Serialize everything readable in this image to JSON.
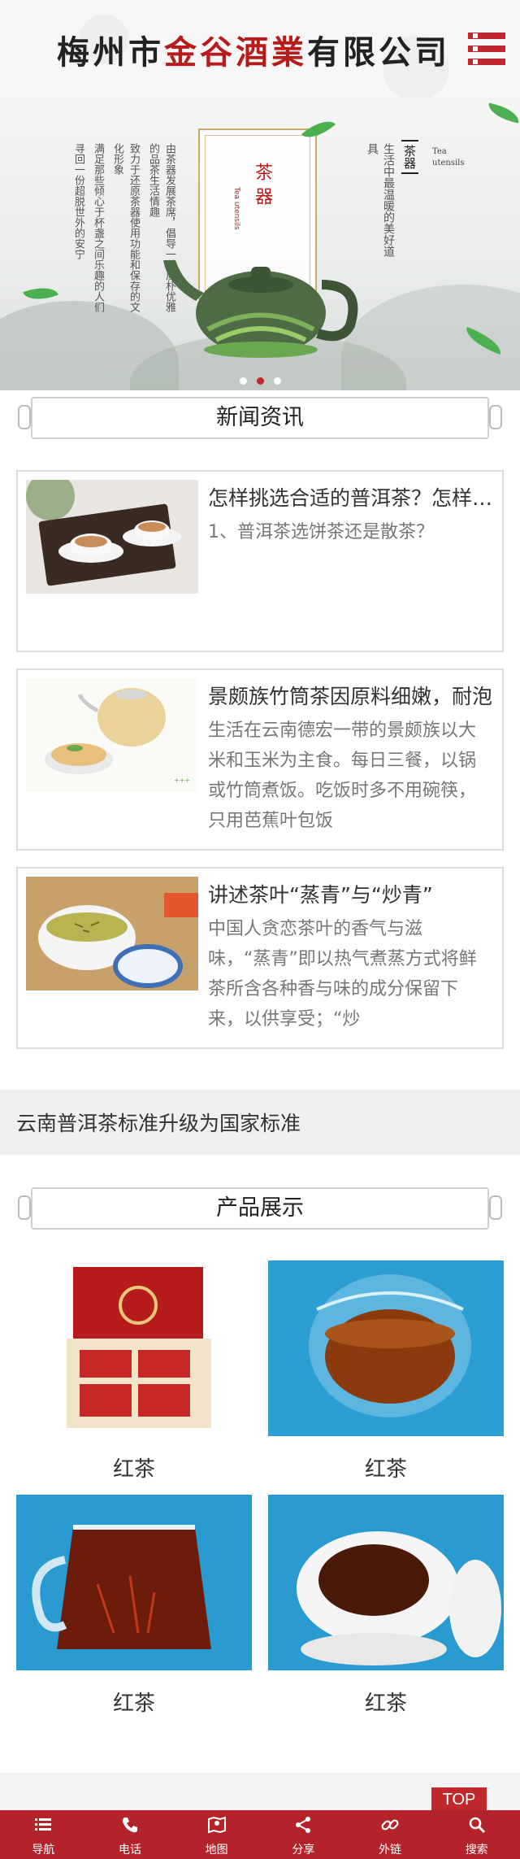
{
  "header": {
    "logo_prefix": "梅州市",
    "logo_brand": "金谷酒業",
    "logo_suffix": "有限公司"
  },
  "banner": {
    "right_title": "茶器",
    "right_en": "Tea utensils",
    "right_text": "生活中最温暖的美好道具",
    "frame_title": "茶器",
    "frame_sub": "Tea utensils",
    "left_text_1": "由茶器发展茶席，倡导一种质朴优雅的品茶生活情趣",
    "left_text_2": "致力于还原茶器使用功能和保存的文化形象",
    "left_text_3": "满足那些倾心于杯盏之间乐趣的人们",
    "left_text_4": "寻回一份超脱世外的安宁"
  },
  "news": {
    "heading": "新闻资讯",
    "items": [
      {
        "title": "怎样挑选合适的普洱茶？怎样挑选合适的普洱茶",
        "desc": "1、普洱茶选饼茶还是散茶？"
      },
      {
        "title": "景颇族竹筒茶因原料细嫩，耐泡",
        "desc": "生活在云南德宏一带的景颇族以大米和玉米为主食。每日三餐，以锅或竹筒煮饭。吃饭时多不用碗筷，只用芭蕉叶包饭"
      },
      {
        "title": "讲述茶叶“蒸青”与“炒青”",
        "desc": "中国人贪恋茶叶的香气与滋味，“蒸青”即以热气煮蒸方式将鲜茶所含各种香与味的成分保留下来，以供享受；“炒"
      }
    ]
  },
  "notice": "云南普洱茶标准升级为国家标准",
  "products": {
    "heading": "产品展示",
    "items": [
      {
        "name": "红茶"
      },
      {
        "name": "红茶"
      },
      {
        "name": "红茶"
      },
      {
        "name": "红茶"
      }
    ]
  },
  "top_button": "TOP",
  "bottom_nav": [
    {
      "label": "导航",
      "icon": "list-icon"
    },
    {
      "label": "电话",
      "icon": "phone-icon"
    },
    {
      "label": "地图",
      "icon": "map-icon"
    },
    {
      "label": "分享",
      "icon": "share-icon"
    },
    {
      "label": "外链",
      "icon": "link-icon"
    },
    {
      "label": "搜索",
      "icon": "search-icon"
    }
  ],
  "colors": {
    "brand_red": "#c0282d",
    "nav_red": "#b4232a"
  }
}
